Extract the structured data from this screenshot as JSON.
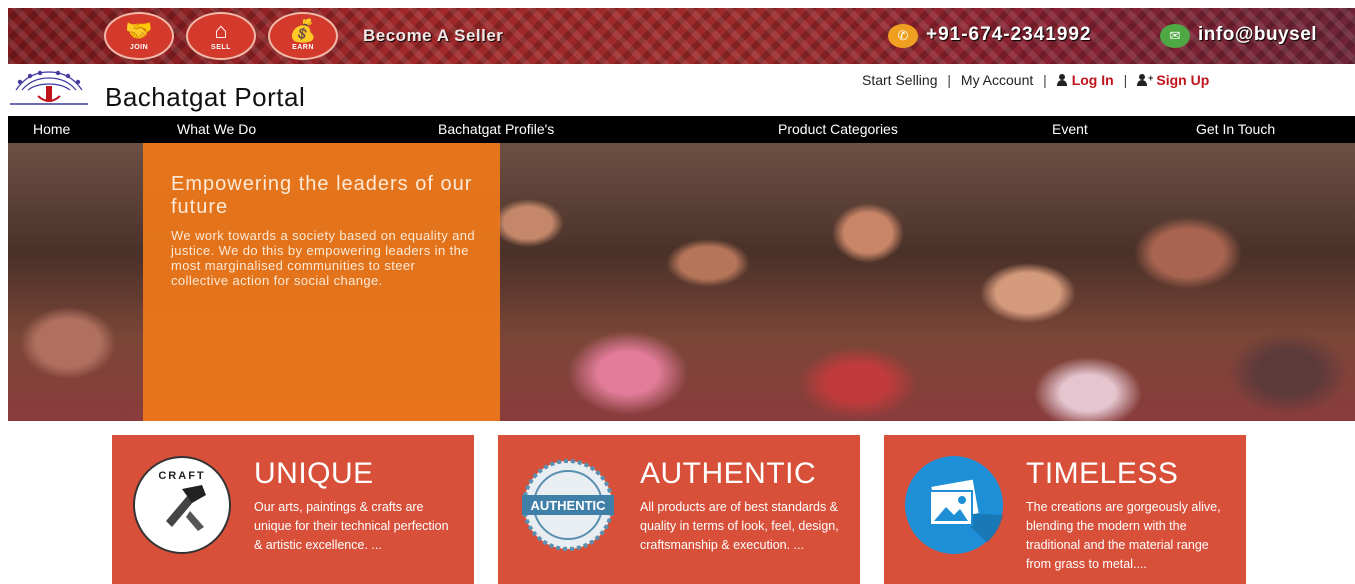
{
  "topbar": {
    "join_label": "JOIN",
    "sell_label": "SELL",
    "earn_label": "EARN",
    "become_seller": "Become A Seller",
    "phone": "+91-674-2341992",
    "email": "info@buysel"
  },
  "brand": {
    "name": "Bachatgat Portal"
  },
  "header_links": {
    "start_selling": "Start Selling",
    "my_account": "My Account",
    "log_in": "Log In",
    "sign_up": "Sign Up",
    "separator": "|"
  },
  "nav": {
    "items": [
      {
        "label": "Home"
      },
      {
        "label": "What We Do"
      },
      {
        "label": "Bachatgat Profile's"
      },
      {
        "label": "Product Categories"
      },
      {
        "label": "Event"
      },
      {
        "label": "Get In Touch"
      }
    ]
  },
  "hero": {
    "title": "Empowering the leaders of our future",
    "text": "We work towards a society based on equality and justice. We do this by empowering leaders in the most marginalised communities to steer collective action for social change."
  },
  "cards": [
    {
      "title": "UNIQUE",
      "text": "Our arts, paintings & crafts are unique for their technical perfection & artistic excellence. ...",
      "badge": "CRAFT"
    },
    {
      "title": "AUTHENTIC",
      "text": "All products are of best standards & quality in terms of look, feel, design, craftsmanship & execution. ...",
      "badge": "AUTHENTIC"
    },
    {
      "title": "TIMELESS",
      "text": "The creations are gorgeously alive, blending the modern with the traditional and the material range from grass to metal...."
    }
  ],
  "colors": {
    "banner": "#9c2a2a",
    "nav_bg": "#000000",
    "hero_panel": "#ee781a",
    "card_bg": "#d8503a",
    "link_red": "#c0141c"
  }
}
